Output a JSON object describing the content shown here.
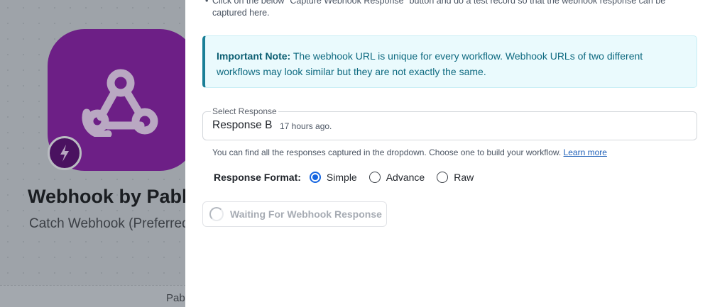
{
  "background": {
    "app_title": "Webhook by Pabbly",
    "app_subtitle": "Catch Webhook (Preferred)",
    "bottom_label": "Pab",
    "icons": {
      "app": "webhook-icon",
      "trigger": "lightning-icon"
    },
    "colors": {
      "app_icon": "#6d1f86",
      "badge": "#4a1260"
    }
  },
  "panel": {
    "instruction_text": "Click on the below \"Capture Webhook Response\" button and do a test record so that the webhook response can be captured here.",
    "note": {
      "title": "Important Note:",
      "text": "The webhook URL is unique for every workflow. Webhook URLs of two different workflows may look similar but they are not exactly the same."
    },
    "select_response": {
      "label": "Select Response",
      "value": "Response B",
      "meta": "17 hours ago."
    },
    "helper_text": "You can find all the responses captured in the dropdown. Choose one to build your workflow.",
    "helper_link": "Learn more",
    "response_format": {
      "label": "Response Format:",
      "options": [
        "Simple",
        "Advance",
        "Raw"
      ],
      "selected": "Simple"
    },
    "waiting_button": "Waiting For Webhook Response",
    "colors": {
      "accent": "#1565e0",
      "note_border": "#1a7f97",
      "note_bg": "#eafafd"
    }
  }
}
